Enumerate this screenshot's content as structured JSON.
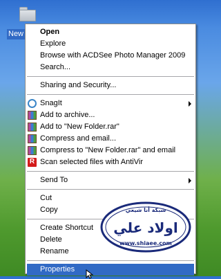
{
  "desktop": {
    "icon_label": "New F"
  },
  "menu": {
    "items": [
      {
        "label": "Open",
        "bold": true
      },
      {
        "label": "Explore"
      },
      {
        "label": "Browse with ACDSee Photo Manager 2009"
      },
      {
        "label": "Search..."
      },
      {
        "label": "Sharing and Security..."
      },
      {
        "label": "SnagIt"
      },
      {
        "label": "Add to archive..."
      },
      {
        "label": "Add to \"New Folder.rar\""
      },
      {
        "label": "Compress and email..."
      },
      {
        "label": "Compress to \"New Folder.rar\" and email"
      },
      {
        "label": "Scan selected files with AntiVir"
      },
      {
        "label": "Send To"
      },
      {
        "label": "Cut"
      },
      {
        "label": "Copy"
      },
      {
        "label": "Create Shortcut"
      },
      {
        "label": "Delete"
      },
      {
        "label": "Rename"
      },
      {
        "label": "Properties",
        "selected": true
      }
    ]
  },
  "watermark": {
    "main_text": "اولاد علي",
    "top_text": "شبكة أنا شيعي",
    "url_text": "www.shiaee.com"
  },
  "icons": {
    "desktop_folder": "folder-icon",
    "sharing": "sharing-icon",
    "snagit": "snagit-icon",
    "winrar": "winrar-icon",
    "antivir": "antivir-icon",
    "submenu": "submenu-arrow-icon",
    "cursor": "mouse-pointer-icon"
  },
  "colors": {
    "selection": "#316ac5",
    "menu_bg": "#ffffff",
    "separator": "#a7a6aa"
  }
}
